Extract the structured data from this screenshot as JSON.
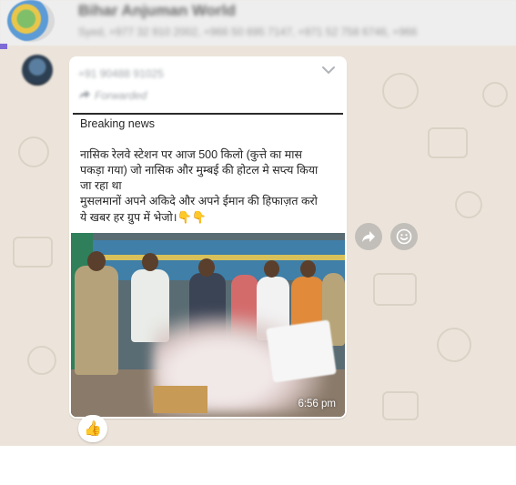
{
  "header": {
    "group_title": "Bihar Anjuman World",
    "participants": "Syed, +977 32 910 2002, +966 50 695 7147, +971 52 758 6746, +966"
  },
  "message": {
    "sender_phone": "+91 90488 91025",
    "forwarded_label": "Forwarded",
    "text_lines": [
      "Breaking news",
      "",
      "नासिक रेलवे स्टेशन पर आज 500 किलो (कुत्ते का मास",
      "पकड़ा गया)  जो नासिक और मुम्बई की होटल मे सप्त्य किया",
      "जा रहा था",
      "मुसलमानों अपने अकिदे और अपने ईमान की हिफाज़त करो",
      "ये खबर हर ग्रुप में भेजो।"
    ],
    "emoji_suffix": "👇👇",
    "time": "6:56 pm",
    "reaction": "👍"
  },
  "icons": {
    "forward": "forward-arrow-icon",
    "emoji": "smiley-icon",
    "menu": "chevron-down-icon"
  },
  "colors": {
    "chat_background": "#ece4da",
    "bubble": "#ffffff",
    "header": "#eeeeee"
  }
}
